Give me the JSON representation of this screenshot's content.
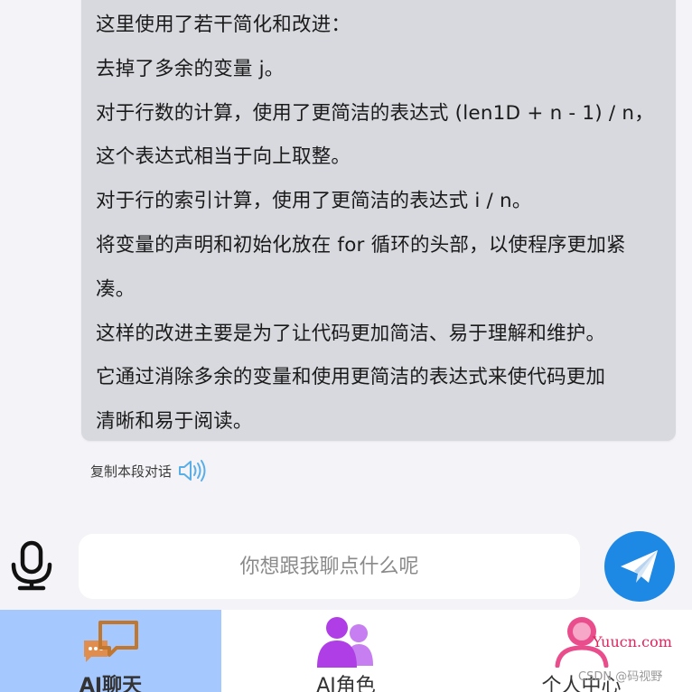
{
  "chat": {
    "message_lines": [
      "这里使用了若干简化和改进：",
      "去掉了多余的变量 j。",
      "对于行数的计算，使用了更简洁的表达式 (len1D + n - 1) / n，",
      "这个表达式相当于向上取整。",
      "对于行的索引计算，使用了更简洁的表达式 i / n。",
      "将变量的声明和初始化放在 for 循环的头部，以使程序更加紧",
      "凑。",
      "这样的改进主要是为了让代码更加简洁、易于理解和维护。",
      "它通过消除多余的变量和使用更简洁的表达式来使代码更加",
      "清晰和易于阅读。"
    ],
    "copy_label": "复制本段对话",
    "speaker_icon": "speaker-icon"
  },
  "input": {
    "placeholder": "你想跟我聊点什么呢",
    "value": "",
    "mic_icon": "microphone-icon",
    "send_icon": "paper-plane-icon"
  },
  "nav": {
    "items": [
      {
        "label": "AI聊天",
        "icon": "chat-bubbles-icon",
        "active": true
      },
      {
        "label": "AI角色",
        "icon": "people-icon",
        "active": false
      },
      {
        "label": "个人中心",
        "icon": "user-profile-icon",
        "active": false
      }
    ]
  },
  "watermarks": {
    "site": "Yuucn.com",
    "csdn": "CSDN @码视野"
  },
  "colors": {
    "bubble_bg": "#d8d9de",
    "send_button": "#1e88e5",
    "nav_active_bg": "#a5c8ff",
    "chat_icon": "#e6873c",
    "role_icon": "#b03ee6",
    "profile_icon": "#ea4d8c",
    "site_watermark": "#e0245e"
  }
}
